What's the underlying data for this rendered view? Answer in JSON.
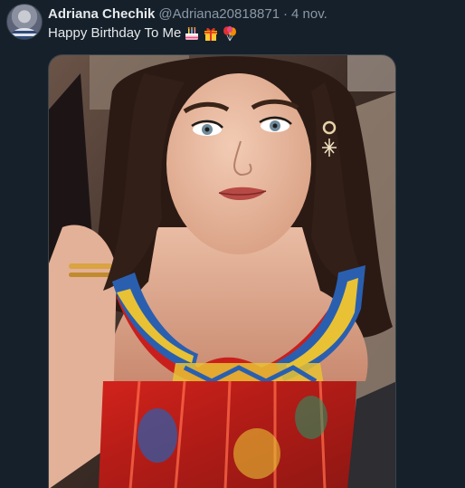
{
  "tweet": {
    "author_name": "Adriana Chechik",
    "author_handle": "@Adriana20818871",
    "separator": "·",
    "time": "4 nov.",
    "text": "Happy Birthday To Me",
    "emojis": [
      "birthday-cake-emoji",
      "wrapped-gift-emoji",
      "balloon-emoji"
    ]
  },
  "avatar": {
    "icon": "person-avatar"
  },
  "media": {
    "icon": "photo-selfie",
    "colors": {
      "background_car": "#3a2b25",
      "hair": "#2b1a14",
      "skin": "#e4b49a",
      "dress_red": "#d2231c",
      "dress_blue": "#2a5fb0",
      "dress_yellow": "#e8c234"
    }
  },
  "theme": {
    "background": "#15202b",
    "primary_text": "#e7e9ea",
    "secondary_text": "#8b98a5",
    "border": "#38444d"
  }
}
